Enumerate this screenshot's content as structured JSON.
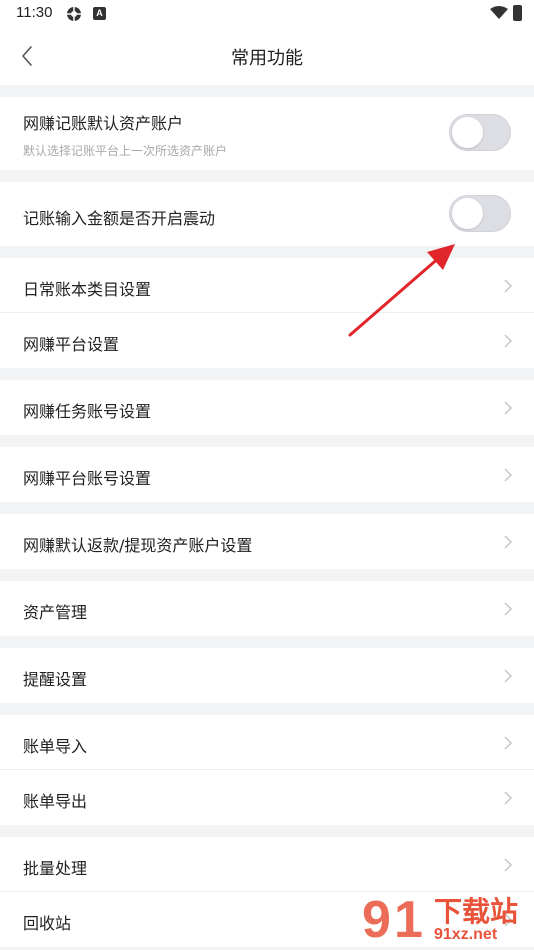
{
  "status_bar": {
    "time": "11:30",
    "a_badge": "A"
  },
  "nav": {
    "title": "常用功能"
  },
  "rows": {
    "default_account": {
      "label": "网赚记账默认资产账户",
      "sub": "默认选择记账平台上一次所选资产账户",
      "toggle_on": false
    },
    "vibrate": {
      "label": "记账输入金额是否开启震动",
      "toggle_on": false
    },
    "daily_category": {
      "label": "日常账本类目设置"
    },
    "platform_settings": {
      "label": "网赚平台设置"
    },
    "task_account": {
      "label": "网赚任务账号设置"
    },
    "platform_account": {
      "label": "网赚平台账号设置"
    },
    "refund_account": {
      "label": "网赚默认返款/提现资产账户设置"
    },
    "asset_manage": {
      "label": "资产管理"
    },
    "reminder": {
      "label": "提醒设置"
    },
    "import": {
      "label": "账单导入"
    },
    "export": {
      "label": "账单导出"
    },
    "batch": {
      "label": "批量处理"
    },
    "recycle": {
      "label": "回收站"
    }
  },
  "watermark": {
    "brand": "下载站",
    "domain": "91xz.net"
  },
  "colors": {
    "annotation_arrow": "#e0262b",
    "toggle_off": "#dcdee4"
  }
}
